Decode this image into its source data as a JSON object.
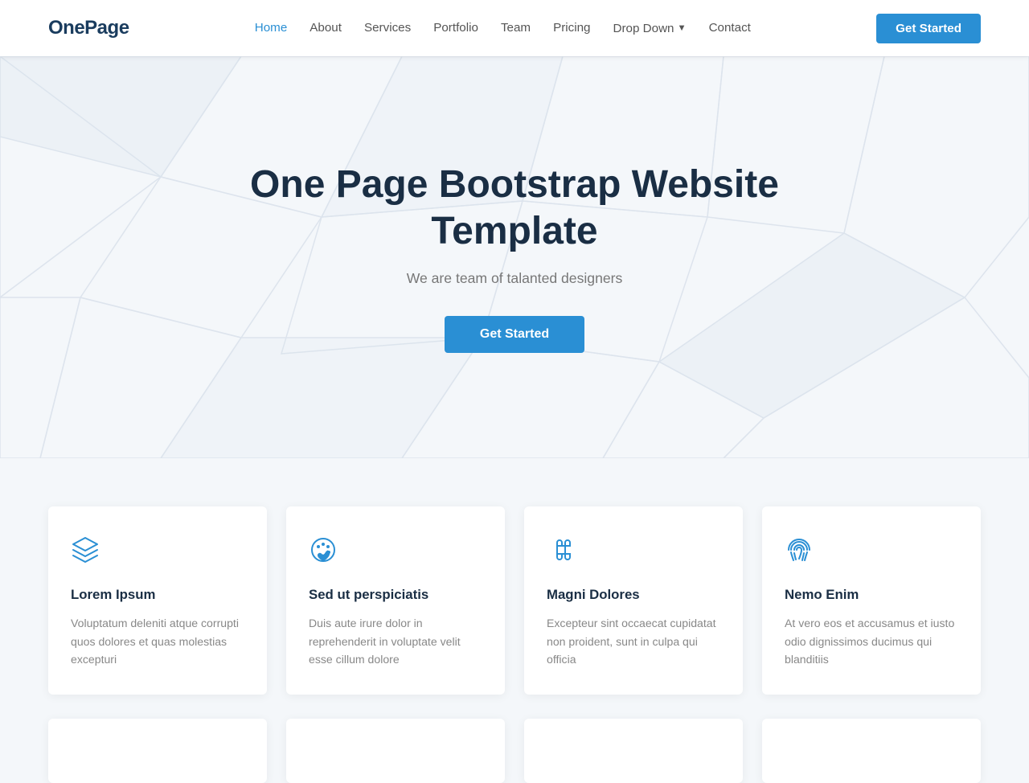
{
  "brand": "OnePage",
  "nav": {
    "links": [
      {
        "id": "home",
        "label": "Home",
        "active": true
      },
      {
        "id": "about",
        "label": "About",
        "active": false
      },
      {
        "id": "services",
        "label": "Services",
        "active": false
      },
      {
        "id": "portfolio",
        "label": "Portfolio",
        "active": false
      },
      {
        "id": "team",
        "label": "Team",
        "active": false
      },
      {
        "id": "pricing",
        "label": "Pricing",
        "active": false
      },
      {
        "id": "dropdown",
        "label": "Drop Down",
        "active": false,
        "hasChevron": true
      },
      {
        "id": "contact",
        "label": "Contact",
        "active": false
      }
    ],
    "cta_label": "Get Started"
  },
  "hero": {
    "title": "One Page Bootstrap Website Template",
    "subtitle": "We are team of talanted designers",
    "cta_label": "Get Started"
  },
  "cards": [
    {
      "id": "card-1",
      "icon": "layers",
      "title": "Lorem Ipsum",
      "text": "Voluptatum deleniti atque corrupti quos dolores et quas molestias excepturi"
    },
    {
      "id": "card-2",
      "icon": "palette",
      "title": "Sed ut perspiciatis",
      "text": "Duis aute irure dolor in reprehenderit in voluptate velit esse cillum dolore"
    },
    {
      "id": "card-3",
      "icon": "command",
      "title": "Magni Dolores",
      "text": "Excepteur sint occaecat cupidatat non proident, sunt in culpa qui officia"
    },
    {
      "id": "card-4",
      "icon": "fingerprint",
      "title": "Nemo Enim",
      "text": "At vero eos et accusamus et iusto odio dignissimos ducimus qui blanditiis"
    }
  ],
  "colors": {
    "brand_blue": "#2a8fd4",
    "dark_navy": "#1a2e44",
    "light_bg": "#f4f7fa",
    "text_muted": "#888"
  }
}
